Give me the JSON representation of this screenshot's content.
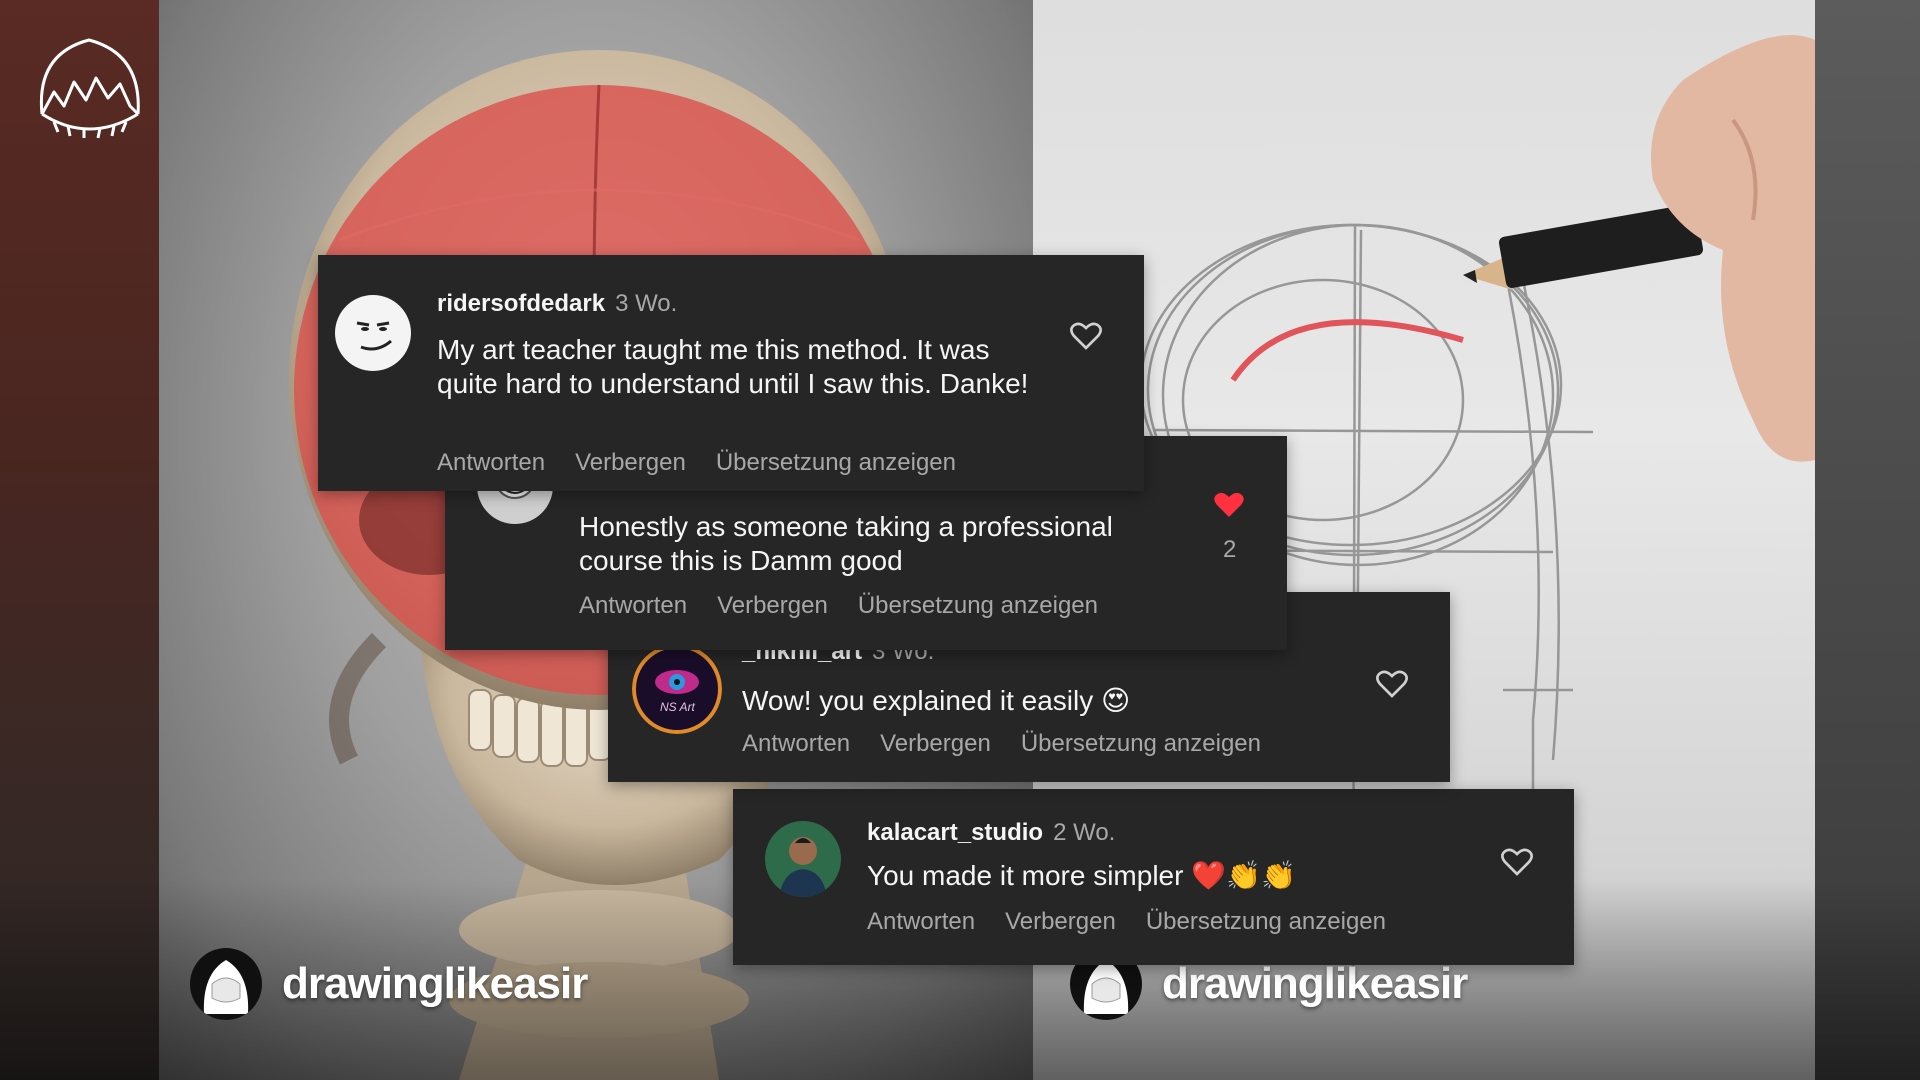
{
  "channel": {
    "handle_left": "drawinglikeasir",
    "handle_right": "drawinglikeasir"
  },
  "comments": [
    {
      "user": "ridersofdedark",
      "time": "3 Wo.",
      "text": "My art teacher taught me this method. It was quite hard to understand until I saw this. Danke!",
      "liked": false
    },
    {
      "user": "",
      "time": "",
      "text": "Honestly as someone taking a professional course this is Damm good",
      "liked": true,
      "like_count": "2"
    },
    {
      "user": "_nikhil_art",
      "time": "3 Wo.",
      "text": "Wow! you explained it easily 😍",
      "liked": false,
      "avatar_text": "NS Art"
    },
    {
      "user": "kalacart_studio",
      "time": "2 Wo.",
      "text": "You made it more simpler ❤️👏👏",
      "liked": false
    }
  ],
  "actions": {
    "reply": "Antworten",
    "hide": "Verbergen",
    "translate": "Übersetzung anzeigen"
  },
  "icons": [
    "heart-outline-icon",
    "heart-filled-icon",
    "channel-logo-icon"
  ],
  "colors": {
    "card_bg": "#262626",
    "muted_text": "#a8a8a8",
    "heart_red": "#ff3040",
    "skull_overlay": "#d9534f"
  }
}
